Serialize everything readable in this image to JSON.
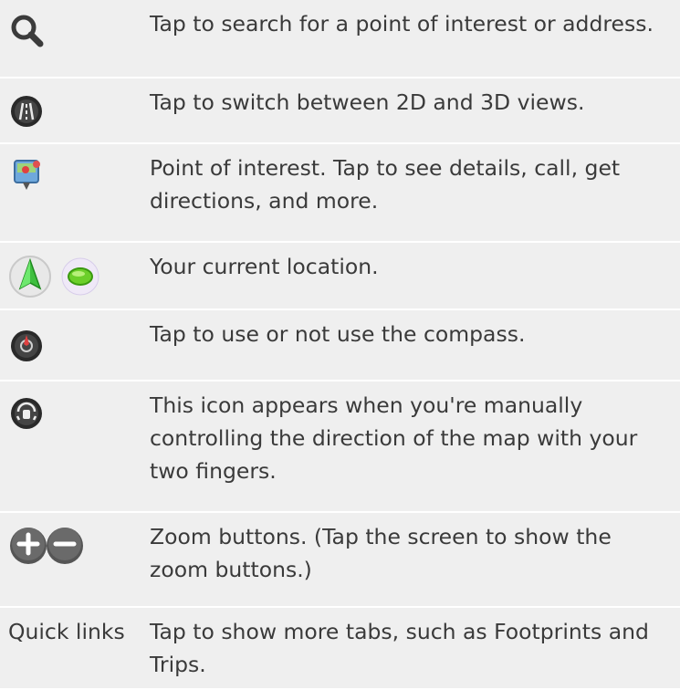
{
  "rows": [
    {
      "icon": "search-icon",
      "description": "Tap to search for a point of interest or address."
    },
    {
      "icon": "2d-3d-view-icon",
      "description": "Tap to switch between 2D and 3D views."
    },
    {
      "icon": "point-of-interest-icon",
      "description": "Point of interest. Tap to see details, call, get directions, and more."
    },
    {
      "icon": "current-location-icon",
      "description": "Your current location."
    },
    {
      "icon": "compass-icon",
      "description": "Tap to use or not use the compass."
    },
    {
      "icon": "manual-rotation-icon",
      "description": "This icon appears when you're manually controlling the direction of the map with your two fingers."
    },
    {
      "icon": "zoom-buttons-icon",
      "description": "Zoom buttons. (Tap the screen to show the zoom buttons.)"
    },
    {
      "label": "Quick links",
      "description": "Tap to show more tabs, such as Footprints and Trips."
    }
  ]
}
